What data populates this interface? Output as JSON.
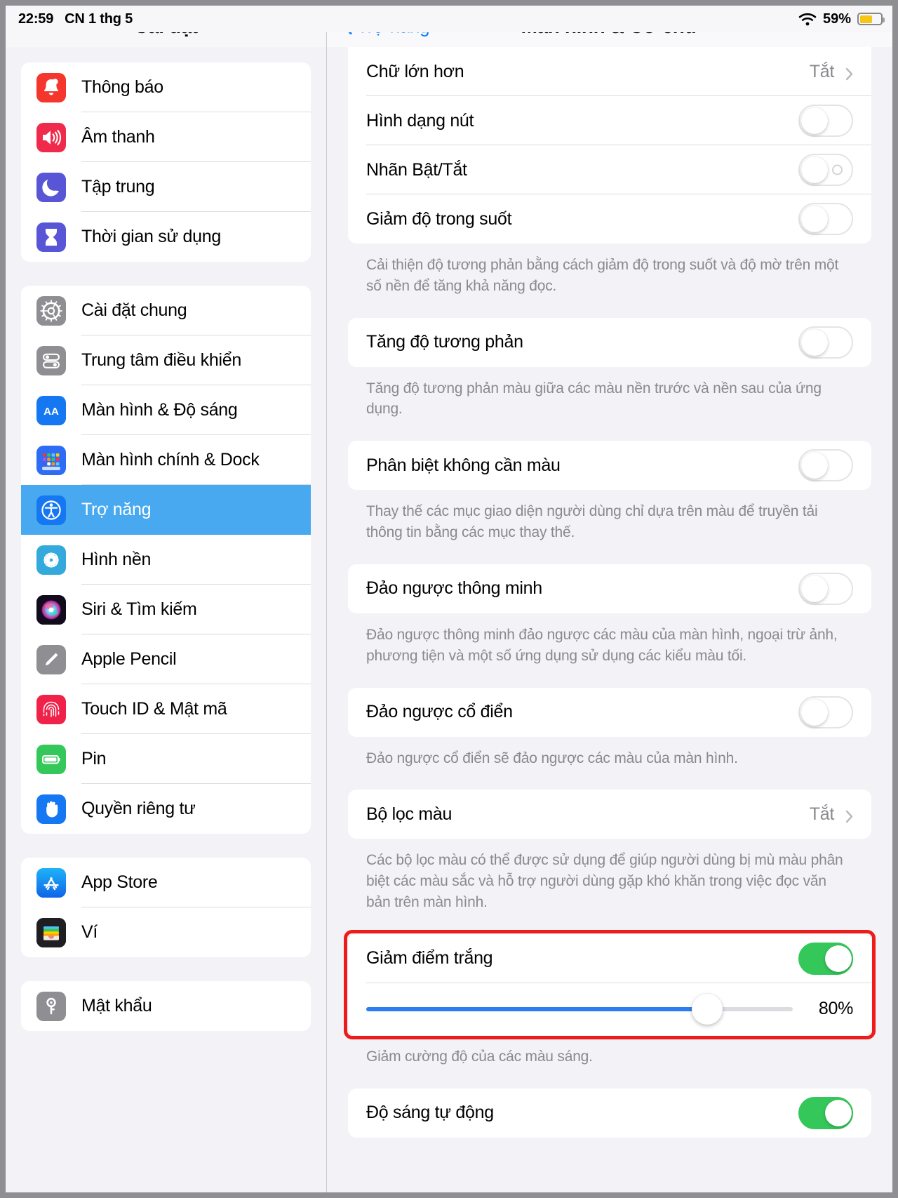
{
  "status_bar": {
    "time": "22:59",
    "date": "CN 1 thg 5",
    "battery_percent": "59%",
    "wifi_icon": "wifi-icon",
    "battery_icon": "battery-icon",
    "battery_color": "#f5c518",
    "battery_level": 59
  },
  "sidebar": {
    "title": "Cài đặt",
    "groups": [
      {
        "items": [
          {
            "label": "Thông báo",
            "icon": "notifications-icon",
            "color": "#f4362c",
            "selected": false
          },
          {
            "label": "Âm thanh",
            "icon": "sounds-icon",
            "color": "#f02a4b",
            "selected": false
          },
          {
            "label": "Tập trung",
            "icon": "focus-icon",
            "color": "#5856d6",
            "selected": false
          },
          {
            "label": "Thời gian sử dụng",
            "icon": "screen-time-icon",
            "color": "#5856d6",
            "selected": false
          }
        ]
      },
      {
        "items": [
          {
            "label": "Cài đặt chung",
            "icon": "general-gear-icon",
            "color": "#8e8e93",
            "selected": false
          },
          {
            "label": "Trung tâm điều khiển",
            "icon": "control-center-icon",
            "color": "#8e8e93",
            "selected": false
          },
          {
            "label": "Màn hình & Độ sáng",
            "icon": "display-brightness-icon",
            "color": "#1577f2",
            "selected": false
          },
          {
            "label": "Màn hình chính & Dock",
            "icon": "home-screen-dock-icon",
            "color": "#2d6cf5",
            "selected": false
          },
          {
            "label": "Trợ năng",
            "icon": "accessibility-icon",
            "color": "#1577f2",
            "selected": true
          },
          {
            "label": "Hình nền",
            "icon": "wallpaper-icon",
            "color": "#34aadc",
            "selected": false
          },
          {
            "label": "Siri & Tìm kiếm",
            "icon": "siri-icon",
            "color": "#1c1c1e",
            "selected": false
          },
          {
            "label": "Apple Pencil",
            "icon": "apple-pencil-icon",
            "color": "#8e8e93",
            "selected": false
          },
          {
            "label": "Touch ID & Mật mã",
            "icon": "touch-id-icon",
            "color": "#f0224a",
            "selected": false
          },
          {
            "label": "Pin",
            "icon": "battery-green-icon",
            "color": "#34c759",
            "selected": false
          },
          {
            "label": "Quyền riêng tư",
            "icon": "privacy-hand-icon",
            "color": "#1577f2",
            "selected": false
          }
        ]
      },
      {
        "items": [
          {
            "label": "App Store",
            "icon": "app-store-icon",
            "color": "#1b8ff5",
            "selected": false
          },
          {
            "label": "Ví",
            "icon": "wallet-icon",
            "color": "#1c1c1e",
            "selected": false
          }
        ]
      },
      {
        "items": [
          {
            "label": "Mật khẩu",
            "icon": "passwords-key-icon",
            "color": "#8e8e93",
            "selected": false
          }
        ]
      }
    ]
  },
  "detail": {
    "back_label": "Trợ năng",
    "back_icon": "chevron-left-icon",
    "title": "Màn hình & Cỡ chữ",
    "rows": {
      "larger_text": {
        "label": "Chữ lớn hơn",
        "value": "Tắt",
        "chevron": "chevron-right-icon"
      },
      "button_shapes": {
        "label": "Hình dạng nút",
        "switch": "off"
      },
      "on_off_labels": {
        "label": "Nhãn Bật/Tắt",
        "switch": "off_labeled"
      },
      "reduce_transparency": {
        "label": "Giảm độ trong suốt",
        "switch": "off"
      },
      "increase_contrast": {
        "label": "Tăng độ tương phản",
        "switch": "off"
      },
      "diff_without_color": {
        "label": "Phân biệt không cần màu",
        "switch": "off"
      },
      "smart_invert": {
        "label": "Đảo ngược thông minh",
        "switch": "off"
      },
      "classic_invert": {
        "label": "Đảo ngược cổ điển",
        "switch": "off"
      },
      "color_filters": {
        "label": "Bộ lọc màu",
        "value": "Tắt",
        "chevron": "chevron-right-icon"
      },
      "reduce_white_point": {
        "label": "Giảm điểm trắng",
        "switch": "on",
        "slider_value": "80%",
        "slider_percent": 80,
        "highlighted": true
      },
      "auto_brightness": {
        "label": "Độ sáng tự động",
        "switch": "on"
      }
    },
    "footnotes": {
      "transparency": "Cải thiện độ tương phản bằng cách giảm độ trong suốt và độ mờ trên một số nền để tăng khả năng đọc.",
      "contrast": "Tăng độ tương phản màu giữa các màu nền trước và nền sau của ứng dụng.",
      "without_color": "Thay thế các mục giao diện người dùng chỉ dựa trên màu để truyền tải thông tin bằng các mục thay thế.",
      "smart_invert": "Đảo ngược thông minh đảo ngược các màu của màn hình, ngoại trừ ảnh, phương tiện và một số ứng dụng sử dụng các kiểu màu tối.",
      "classic_invert": "Đảo ngược cổ điển sẽ đảo ngược các màu của màn hình.",
      "color_filters": "Các bộ lọc màu có thể được sử dụng để giúp người dùng bị mù màu phân biệt các màu sắc và hỗ trợ người dùng gặp khó khăn trong việc đọc văn bản trên màn hình.",
      "white_point": "Giảm cường độ của các màu sáng."
    }
  },
  "theme": {
    "accent_blue": "#0a7cff",
    "selected_row": "#48a9f0",
    "switch_on": "#34c759",
    "slider_fill": "#2b7ff0",
    "highlight_border": "#ee1b1b",
    "group_bg": "#ffffff",
    "page_bg": "#f2f2f7"
  }
}
